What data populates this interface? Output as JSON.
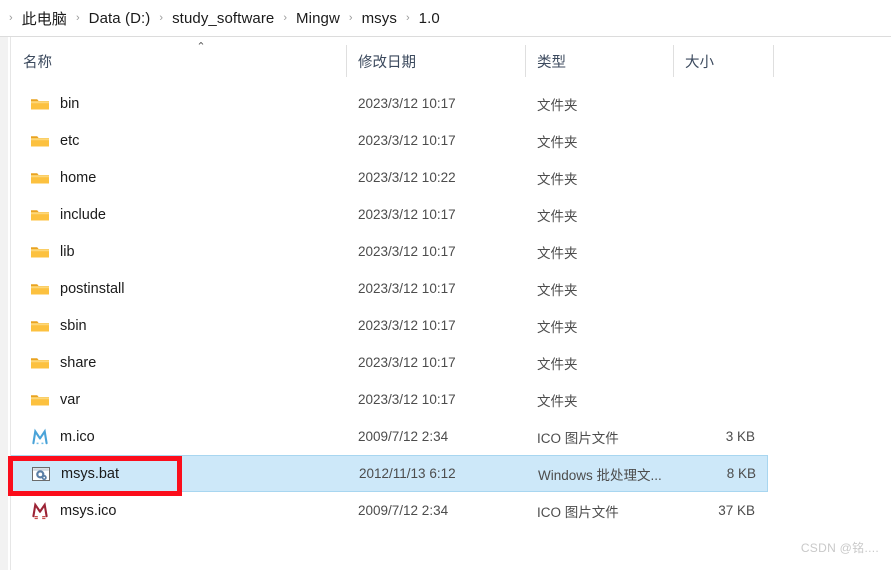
{
  "breadcrumb": {
    "leading_separator": "›",
    "separator": "›",
    "items": [
      {
        "label": "此电脑"
      },
      {
        "label": "Data (D:)"
      },
      {
        "label": "study_software"
      },
      {
        "label": "Mingw"
      },
      {
        "label": "msys"
      },
      {
        "label": "1.0"
      }
    ]
  },
  "columns": {
    "name": "名称",
    "date_modified": "修改日期",
    "type": "类型",
    "size": "大小",
    "sort_indicator": "⌃"
  },
  "rows": [
    {
      "icon": "folder-icon",
      "name": "bin",
      "date": "2023/3/12 10:17",
      "type": "文件夹",
      "size": "",
      "selected": false
    },
    {
      "icon": "folder-icon",
      "name": "etc",
      "date": "2023/3/12 10:17",
      "type": "文件夹",
      "size": "",
      "selected": false
    },
    {
      "icon": "folder-icon",
      "name": "home",
      "date": "2023/3/12 10:22",
      "type": "文件夹",
      "size": "",
      "selected": false
    },
    {
      "icon": "folder-icon",
      "name": "include",
      "date": "2023/3/12 10:17",
      "type": "文件夹",
      "size": "",
      "selected": false
    },
    {
      "icon": "folder-icon",
      "name": "lib",
      "date": "2023/3/12 10:17",
      "type": "文件夹",
      "size": "",
      "selected": false
    },
    {
      "icon": "folder-icon",
      "name": "postinstall",
      "date": "2023/3/12 10:17",
      "type": "文件夹",
      "size": "",
      "selected": false
    },
    {
      "icon": "folder-icon",
      "name": "sbin",
      "date": "2023/3/12 10:17",
      "type": "文件夹",
      "size": "",
      "selected": false
    },
    {
      "icon": "folder-icon",
      "name": "share",
      "date": "2023/3/12 10:17",
      "type": "文件夹",
      "size": "",
      "selected": false
    },
    {
      "icon": "folder-icon",
      "name": "var",
      "date": "2023/3/12 10:17",
      "type": "文件夹",
      "size": "",
      "selected": false
    },
    {
      "icon": "ico-blue-m-icon",
      "name": "m.ico",
      "date": "2009/7/12 2:34",
      "type": "ICO 图片文件",
      "size": "3 KB",
      "selected": false
    },
    {
      "icon": "bat-file-icon",
      "name": "msys.bat",
      "date": "2012/11/13 6:12",
      "type": "Windows 批处理文...",
      "size": "8 KB",
      "selected": true
    },
    {
      "icon": "ico-red-m-icon",
      "name": "msys.ico",
      "date": "2009/7/12 2:34",
      "type": "ICO 图片文件",
      "size": "37 KB",
      "selected": false
    }
  ],
  "annotation": {
    "shape": "rectangle",
    "color": "#fb0d1b",
    "targets": "msys.bat"
  },
  "watermark": {
    "text": "CSDN @铭...."
  },
  "colors": {
    "selection_fill": "#cde8f9",
    "selection_border": "#a8d6f0",
    "header_text": "#3c4a5e",
    "body_text": "#1b1b1b",
    "secondary_text": "#4c4c4c",
    "divider": "#dcdcdc",
    "annotation_red": "#fb0d1b",
    "folder_yellow": "#fcc13f"
  }
}
